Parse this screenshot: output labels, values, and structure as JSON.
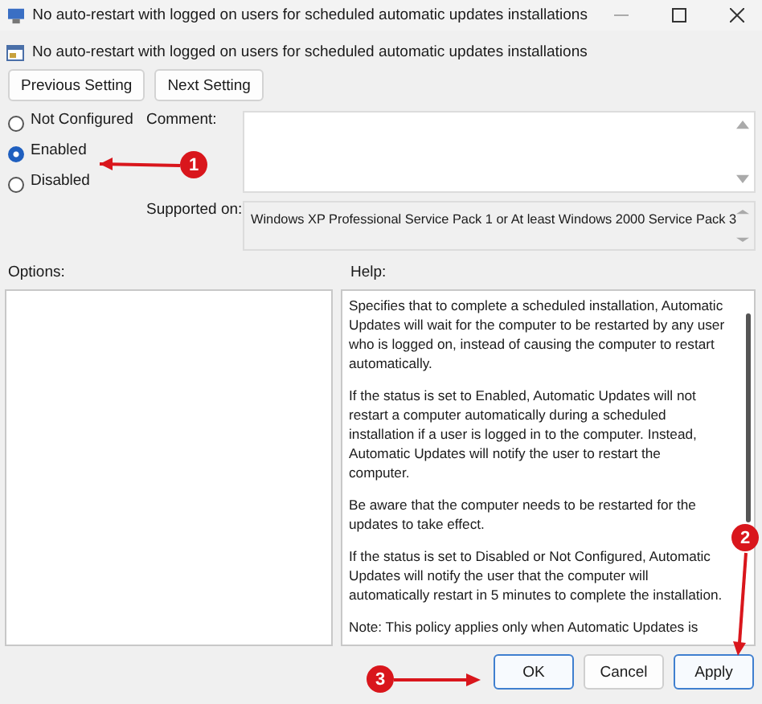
{
  "window": {
    "title": "No auto-restart with logged on users for scheduled automatic updates installations"
  },
  "policy_title": "No auto-restart with logged on users for scheduled automatic updates installations",
  "nav_buttons": [
    "Previous Setting",
    "Next Setting"
  ],
  "state_options": [
    {
      "label": "Not Configured",
      "selected": false
    },
    {
      "label": "Enabled",
      "selected": true
    },
    {
      "label": "Disabled",
      "selected": false
    }
  ],
  "comment": {
    "label": "Comment:"
  },
  "supported_on": {
    "label": "Supported on:",
    "value": "Windows XP Professional Service Pack 1 or At least Windows 2000 Service Pack 3"
  },
  "options": {
    "label": "Options:"
  },
  "help": {
    "label": "Help:",
    "paragraphs": [
      "Specifies that to complete a scheduled installation, Automatic Updates will wait for the computer to be restarted by any user who is logged on, instead of causing the computer to restart automatically.",
      "If the status is set to Enabled, Automatic Updates will not restart a computer automatically during a scheduled installation if a user is logged in to the computer. Instead, Automatic Updates will notify the user to restart the computer.",
      "Be aware that the computer needs to be restarted for the updates to take effect.",
      "If the status is set to Disabled or Not Configured, Automatic Updates will notify the user that the computer will automatically restart in 5 minutes to complete the installation.",
      "Note: This policy applies only when Automatic Updates is"
    ]
  },
  "buttons": [
    {
      "label": "OK",
      "highlighted": true
    },
    {
      "label": "Cancel",
      "highlighted": false
    },
    {
      "label": "Apply",
      "highlighted": true
    }
  ],
  "annotations": [
    {
      "number": "1"
    },
    {
      "number": "2"
    },
    {
      "number": "3"
    }
  ]
}
